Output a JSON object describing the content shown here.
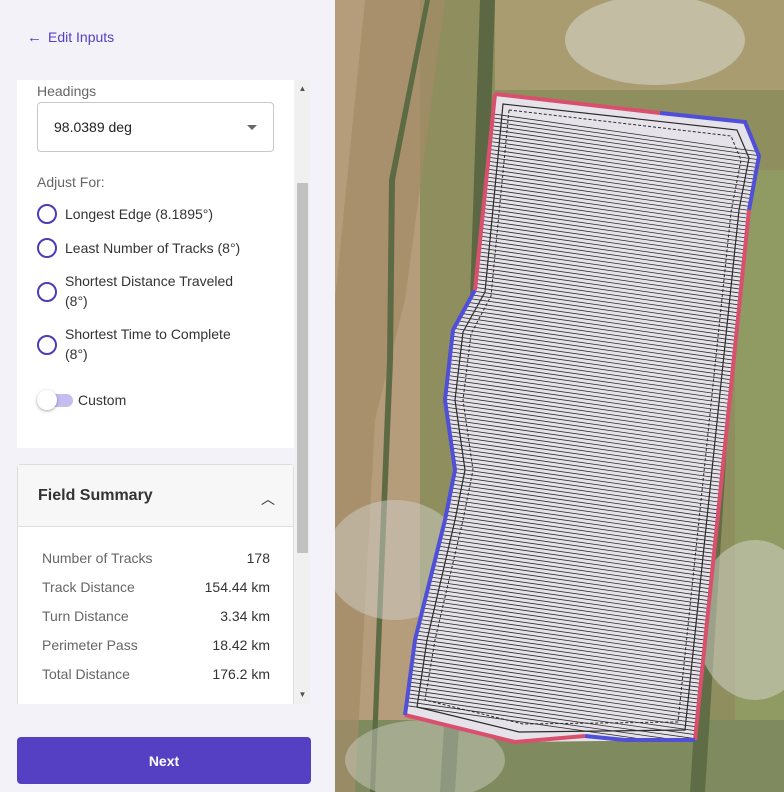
{
  "header": {
    "back_label": "Edit Inputs"
  },
  "headings": {
    "label": "Headings",
    "value": "98.0389 deg"
  },
  "adjust": {
    "label": "Adjust For:",
    "options": [
      "Longest Edge (8.1895°)",
      "Least Number of Tracks (8°)",
      "Shortest Distance Traveled (8°)",
      "Shortest Time to Complete (8°)"
    ],
    "custom_label": "Custom",
    "custom_enabled": false
  },
  "summary": {
    "title": "Field Summary",
    "rows": [
      {
        "key": "Number of Tracks",
        "value": "178"
      },
      {
        "key": "Track Distance",
        "value": "154.44 km"
      },
      {
        "key": "Turn Distance",
        "value": "3.34 km"
      },
      {
        "key": "Perimeter Pass",
        "value": "18.42 km"
      },
      {
        "key": "Total Distance",
        "value": "176.2 km"
      }
    ]
  },
  "footer": {
    "next_label": "Next"
  },
  "colors": {
    "accent": "#5540c4",
    "perimeter_red": "#d9506e",
    "perimeter_blue": "#4f4fd8"
  }
}
